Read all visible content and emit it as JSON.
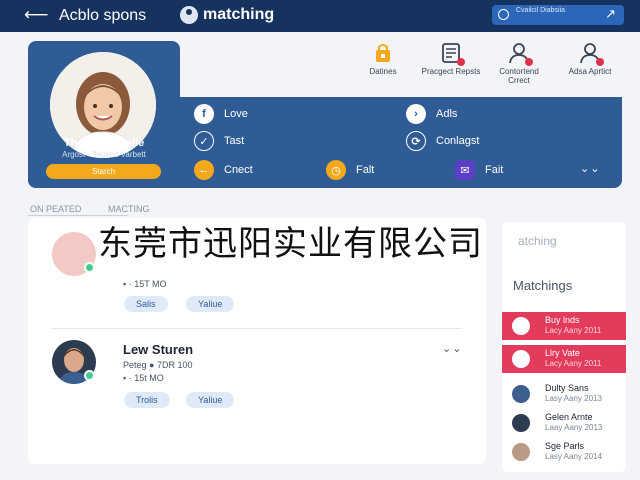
{
  "topbar": {
    "back_icon": "arrow-left-icon",
    "title": "Acblo spons",
    "brand": "matching",
    "action_label": "Cvailcil Diabsiia",
    "action_icon": "arrow-up-right-icon"
  },
  "profile": {
    "name": "Tharsinal Welle",
    "subtitle": "Argost - Tedend Varbett",
    "button": "Starch"
  },
  "quick_actions": [
    {
      "label": "Datines",
      "icon": "lock-icon",
      "color": "#f4a91c"
    },
    {
      "label": "Pracgect Repsts",
      "icon": "document-icon",
      "color": "#3a4456"
    },
    {
      "label": "Contortend Crrect",
      "icon": "user-icon",
      "color": "#3a4456"
    },
    {
      "label": "Adsa Aprtict",
      "icon": "user-icon",
      "color": "#3a4456"
    }
  ],
  "menu": [
    {
      "label": "Love",
      "icon": "facebook-icon",
      "style": "white",
      "glyph": "f"
    },
    {
      "label": "Adls",
      "icon": "chevron-right-icon",
      "style": "white",
      "glyph": "›"
    },
    {
      "label": "Tast",
      "icon": "check-icon",
      "style": "outline",
      "glyph": "✓"
    },
    {
      "label": "Conlagst",
      "icon": "refresh-icon",
      "style": "outline",
      "glyph": "⟳"
    },
    {
      "label": "Cnect",
      "icon": "arrow-left-icon",
      "style": "orange",
      "glyph": "←"
    },
    {
      "label": "Falt",
      "icon": "clock-icon",
      "style": "orange",
      "glyph": "◷"
    },
    {
      "label": "Fait",
      "icon": "chat-icon",
      "style": "purple",
      "glyph": "✉"
    }
  ],
  "tabs": [
    "ON PEATED",
    "MACTING"
  ],
  "list": [
    {
      "name": "",
      "line1": "",
      "line2": "▪ · 15T MO",
      "chips": [
        "Salis",
        "Yaliue"
      ]
    },
    {
      "name": "Lew Sturen",
      "line1": "Peteg ● 7DR 100",
      "line2": "▪ · 15t MO",
      "chips": [
        "Trolis",
        "Yaliue"
      ]
    }
  ],
  "right_panel": {
    "ghost": "atching",
    "title": "Matchings",
    "items": [
      {
        "name": "Buy lnds",
        "sub": "Lacy Aany 2011",
        "highlight": true
      },
      {
        "name": "Llry Vate",
        "sub": "Lacy Aany 2011",
        "highlight": true
      },
      {
        "name": "Dulty Sans",
        "sub": "Lasy Aany 2013",
        "highlight": false
      },
      {
        "name": "Gelen Arnte",
        "sub": "Laay Aany 2013",
        "highlight": false
      },
      {
        "name": "Sge Parls",
        "sub": "Lasy Aany 2014",
        "highlight": false
      }
    ]
  },
  "overlay_text": "东莞市迅阳实业有限公司"
}
